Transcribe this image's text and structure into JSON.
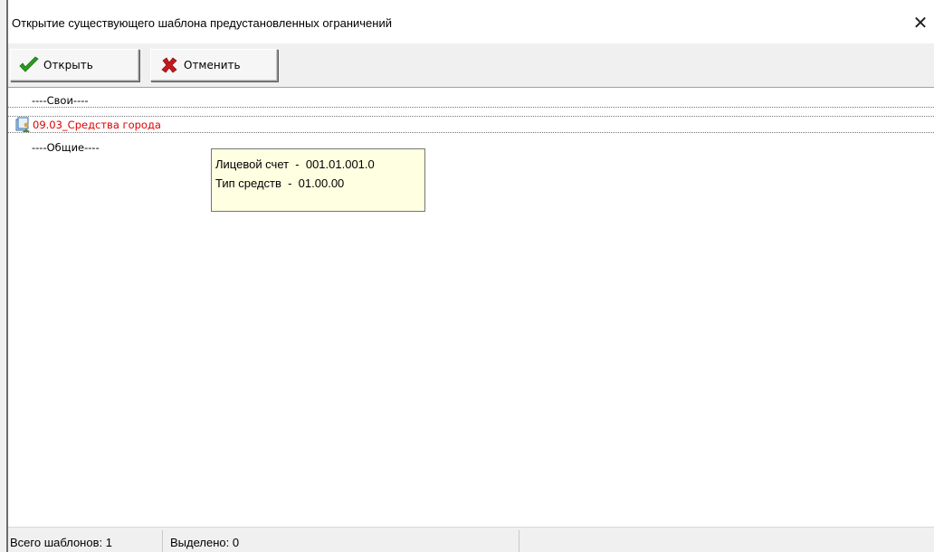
{
  "window": {
    "title": "Открытие существующего шаблона предустановленных ограничений",
    "close_glyph": "✕"
  },
  "toolbar": {
    "open_label": "Открыть",
    "open_icon": "checkmark-icon",
    "cancel_label": "Отменить",
    "cancel_icon": "red-x-icon"
  },
  "tree": {
    "own_group": "----Свои----",
    "template_name": "09.03_Средства города",
    "template_icon": "template-user-icon",
    "common_group": "----Общие----"
  },
  "tooltip": {
    "line1": "Лицевой счет  -  001.01.001.0",
    "line2": "Тип средств  -  01.00.00"
  },
  "status": {
    "total_templates": "Всего шаблонов: 1",
    "selected": "Выделено: 0"
  },
  "colors": {
    "template_text": "#e00000",
    "tooltip_bg": "#ffffe1",
    "check_green": "#2a9d1f",
    "cancel_red": "#c8161d"
  }
}
